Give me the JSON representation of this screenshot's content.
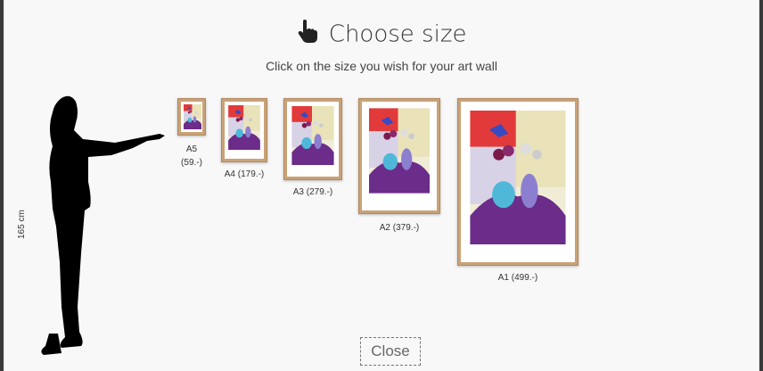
{
  "modal": {
    "title": "Choose size",
    "title_icon": "pointing-hand-icon",
    "subtitle": "Click on the size you wish for your art wall",
    "height_label": "165 cm",
    "close_label": "Close"
  },
  "sizes": [
    {
      "name": "A5",
      "price": "(59.-)"
    },
    {
      "name": "A4",
      "label": "A4 (179.-)"
    },
    {
      "name": "A3",
      "label": "A3 (279.-)"
    },
    {
      "name": "A2",
      "label": "A2 (379.-)"
    },
    {
      "name": "A1",
      "label": "A1 (499.-)"
    }
  ],
  "colors": {
    "frame": "#c9a277",
    "painting_red": "#e23a3a",
    "painting_purple": "#6b2c8a",
    "vase_blue": "#4fb8d8"
  }
}
